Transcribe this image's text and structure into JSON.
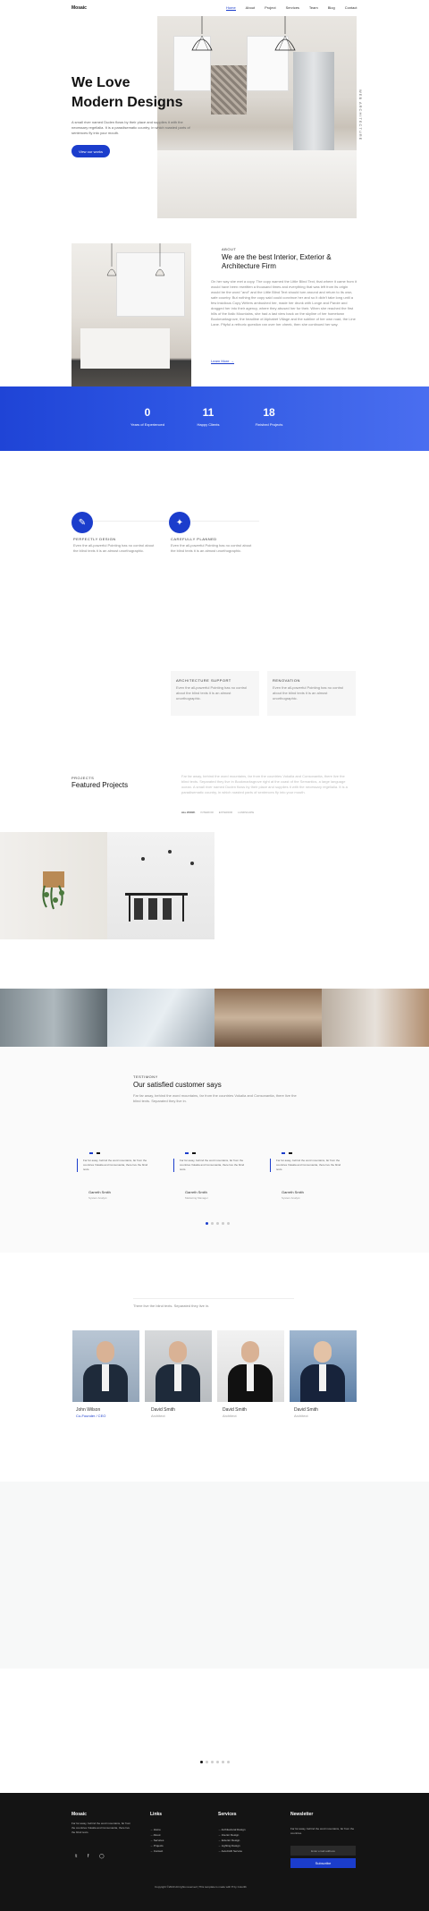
{
  "header": {
    "logo": "Mosaic",
    "nav": [
      "Home",
      "About",
      "Project",
      "Services",
      "Team",
      "Blog",
      "Contact"
    ]
  },
  "hero": {
    "title_line1": "We Love",
    "title_line2": "Modern Designs",
    "text": "A small river named Duden flows by their place and supplies it with the necessary regelialia. It is a paradisematic country, in which roasted parts of sentences fly into your mouth.",
    "button": "View our works",
    "vertical_label": "WEB ARCHITECTURE"
  },
  "about": {
    "label": "ABOUT",
    "title": "We are the best Interior, Exterior & Architecture Firm",
    "text": "On her way she met a copy. The copy warned the Little Blind Text, that where it came from it would have been rewritten a thousand times and everything that was left from its origin would be the word \"and\" and the Little Blind Text should turn around and return to its own, safe country. But nothing the copy said could convince her and so it didn't take long until a few insidious Copy Writers ambushed her, made her drunk with Longe and Parole and dragged her into their agency, where they abused her for their. When she reached the first hills of the Italic Mountains, she had a last view back on the skyline of her hometown Bookmarksgrove, the headline of Alphabet Village and the subline of her own road, the Line Lane. Pityful a rethoric question ran over her cheek, then she continued her way.",
    "link": "Learn More →"
  },
  "counters": [
    {
      "number": "0",
      "label": "Years of Experienced"
    },
    {
      "number": "11",
      "label": "Happy Clients"
    },
    {
      "number": "18",
      "label": "Finished Projects"
    }
  ],
  "services": [
    {
      "title": "PERFECTLY DESIGN",
      "text": "Even the all-powerful Pointing has no control about the blind texts it is an almost unorthographic.",
      "icon": "ruler-icon"
    },
    {
      "title": "CAREFULLY PLANNED",
      "text": "Even the all-powerful Pointing has no control about the blind texts it is an almost unorthographic.",
      "icon": "compass-icon"
    },
    {
      "title": "ARCHITECTURE SUPPORT",
      "text": "Even the all-powerful Pointing has no control about the blind texts it is an almost unorthographic."
    },
    {
      "title": "RENOVATION",
      "text": "Even the all-powerful Pointing has no control about the blind texts it is an almost unorthographic."
    }
  ],
  "projects": {
    "label": "PROJECTS",
    "title": "Featured Projects",
    "text": "Far far away, behind the word mountains, far from the countries Vokalia and Consonantia, there live the blind texts. Separated they live in Bookmarksgrove right at the coast of the Semantics, a large language ocean. A small river named Duden flows by their place and supplies it with the necessary regelialia. It is a paradisematic country, in which roasted parts of sentences fly into your mouth.",
    "filters": [
      "ALL WORK",
      "INTERIOR",
      "EXTERIOR",
      "LANDSCAPE"
    ]
  },
  "testimonials": {
    "label": "TESTIMONY",
    "title": "Our satisfied customer says",
    "text": "Far far away, behind the word mountains, far from the countries Vokalia and Consonantia, there live the blind texts. Separated they live in.",
    "items": [
      {
        "quote": "Far far away, behind the word mountains, far from the countries Vokalia and Consonantia, there live the blind texts.",
        "name": "Garreth Smith",
        "role": "System Analyst"
      },
      {
        "quote": "Far far away, behind the word mountains, far from the countries Vokalia and Consonantia, there live the blind texts.",
        "name": "Garreth Smith",
        "role": "Marketing Manager"
      },
      {
        "quote": "Far far away, behind the word mountains, far from the countries Vokalia and Consonantia, there live the blind texts.",
        "name": "Garreth Smith",
        "role": "System Analyst"
      }
    ]
  },
  "team": {
    "text": "There live the blind texts. Separated they live in.",
    "members": [
      {
        "name": "John Wilson",
        "role": "Co-Founder / CEO"
      },
      {
        "name": "David Smith",
        "role": "Architect"
      },
      {
        "name": "David Smith",
        "role": "Architect"
      },
      {
        "name": "David Smith",
        "role": "Architect"
      }
    ]
  },
  "footer": {
    "brand": "Mosaic",
    "brand_text": "Far far away, behind the word mountains, far from the countries Vokalia and Consonantia, there live the blind texts.",
    "links_title": "Links",
    "links": [
      "Home",
      "About",
      "Services",
      "Projects",
      "Contact"
    ],
    "services_title": "Services",
    "services": [
      "Architectural Design",
      "Interior Design",
      "Exterior Design",
      "Lighting Design",
      "AutoCAD Service"
    ],
    "newsletter_title": "Newsletter",
    "newsletter_text": "Far far away, behind the word mountains, far from the countries.",
    "newsletter_placeholder": "Enter email address",
    "subscribe": "Subscribe",
    "copyright": "Copyright ©2023 All rights reserved | This template is made with ♥ by Colorlib"
  },
  "colors": {
    "accent": "#1b3dcc",
    "footer_bg": "#141414"
  }
}
